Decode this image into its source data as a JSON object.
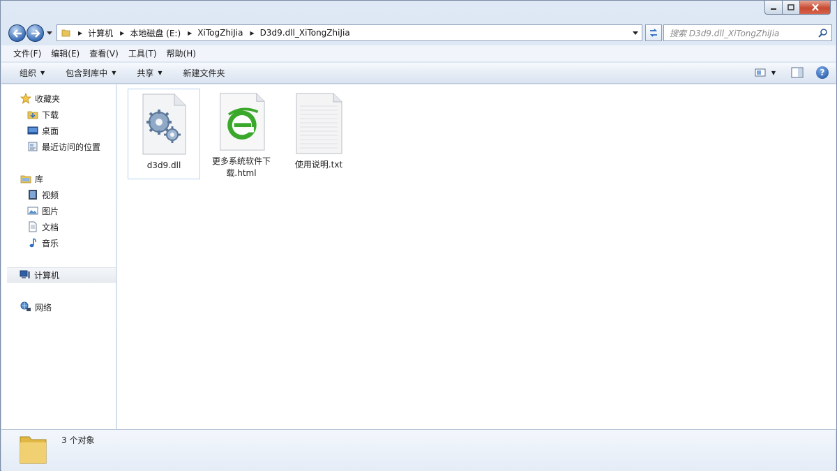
{
  "window": {
    "minimize_symbol": "—",
    "maximize_symbol": "□",
    "close_symbol": "✕"
  },
  "address": {
    "breadcrumbs": [
      "计算机",
      "本地磁盘 (E:)",
      "XiTogZhiJia",
      "D3d9.dll_XiTongZhiJia"
    ],
    "search_placeholder": "搜索 D3d9.dll_XiTongZhiJia"
  },
  "menubar": {
    "items": [
      "文件(F)",
      "编辑(E)",
      "查看(V)",
      "工具(T)",
      "帮助(H)"
    ]
  },
  "commandbar": {
    "organize": "组织",
    "include_in_library": "包含到库中",
    "share": "共享",
    "new_folder": "新建文件夹",
    "help": "?"
  },
  "navpane": {
    "favorites": {
      "label": "收藏夹",
      "items": [
        "下载",
        "桌面",
        "最近访问的位置"
      ]
    },
    "libraries": {
      "label": "库",
      "items": [
        "视频",
        "图片",
        "文档",
        "音乐"
      ]
    },
    "computer": "计算机",
    "network": "网络"
  },
  "files": [
    {
      "name": "d3d9.dll",
      "type": "dll-file-icon",
      "selected": true
    },
    {
      "name": "更多系统软件下载.html",
      "type": "html-file-icon",
      "selected": false
    },
    {
      "name": "使用说明.txt",
      "type": "txt-file-icon",
      "selected": false
    }
  ],
  "details": {
    "count_text": "3 个对象"
  },
  "colors": {
    "accent": "#3b6fb6",
    "close": "#c74a32",
    "selection_border": "#b8d1ee",
    "html_icon_green": "#3aa82b"
  }
}
